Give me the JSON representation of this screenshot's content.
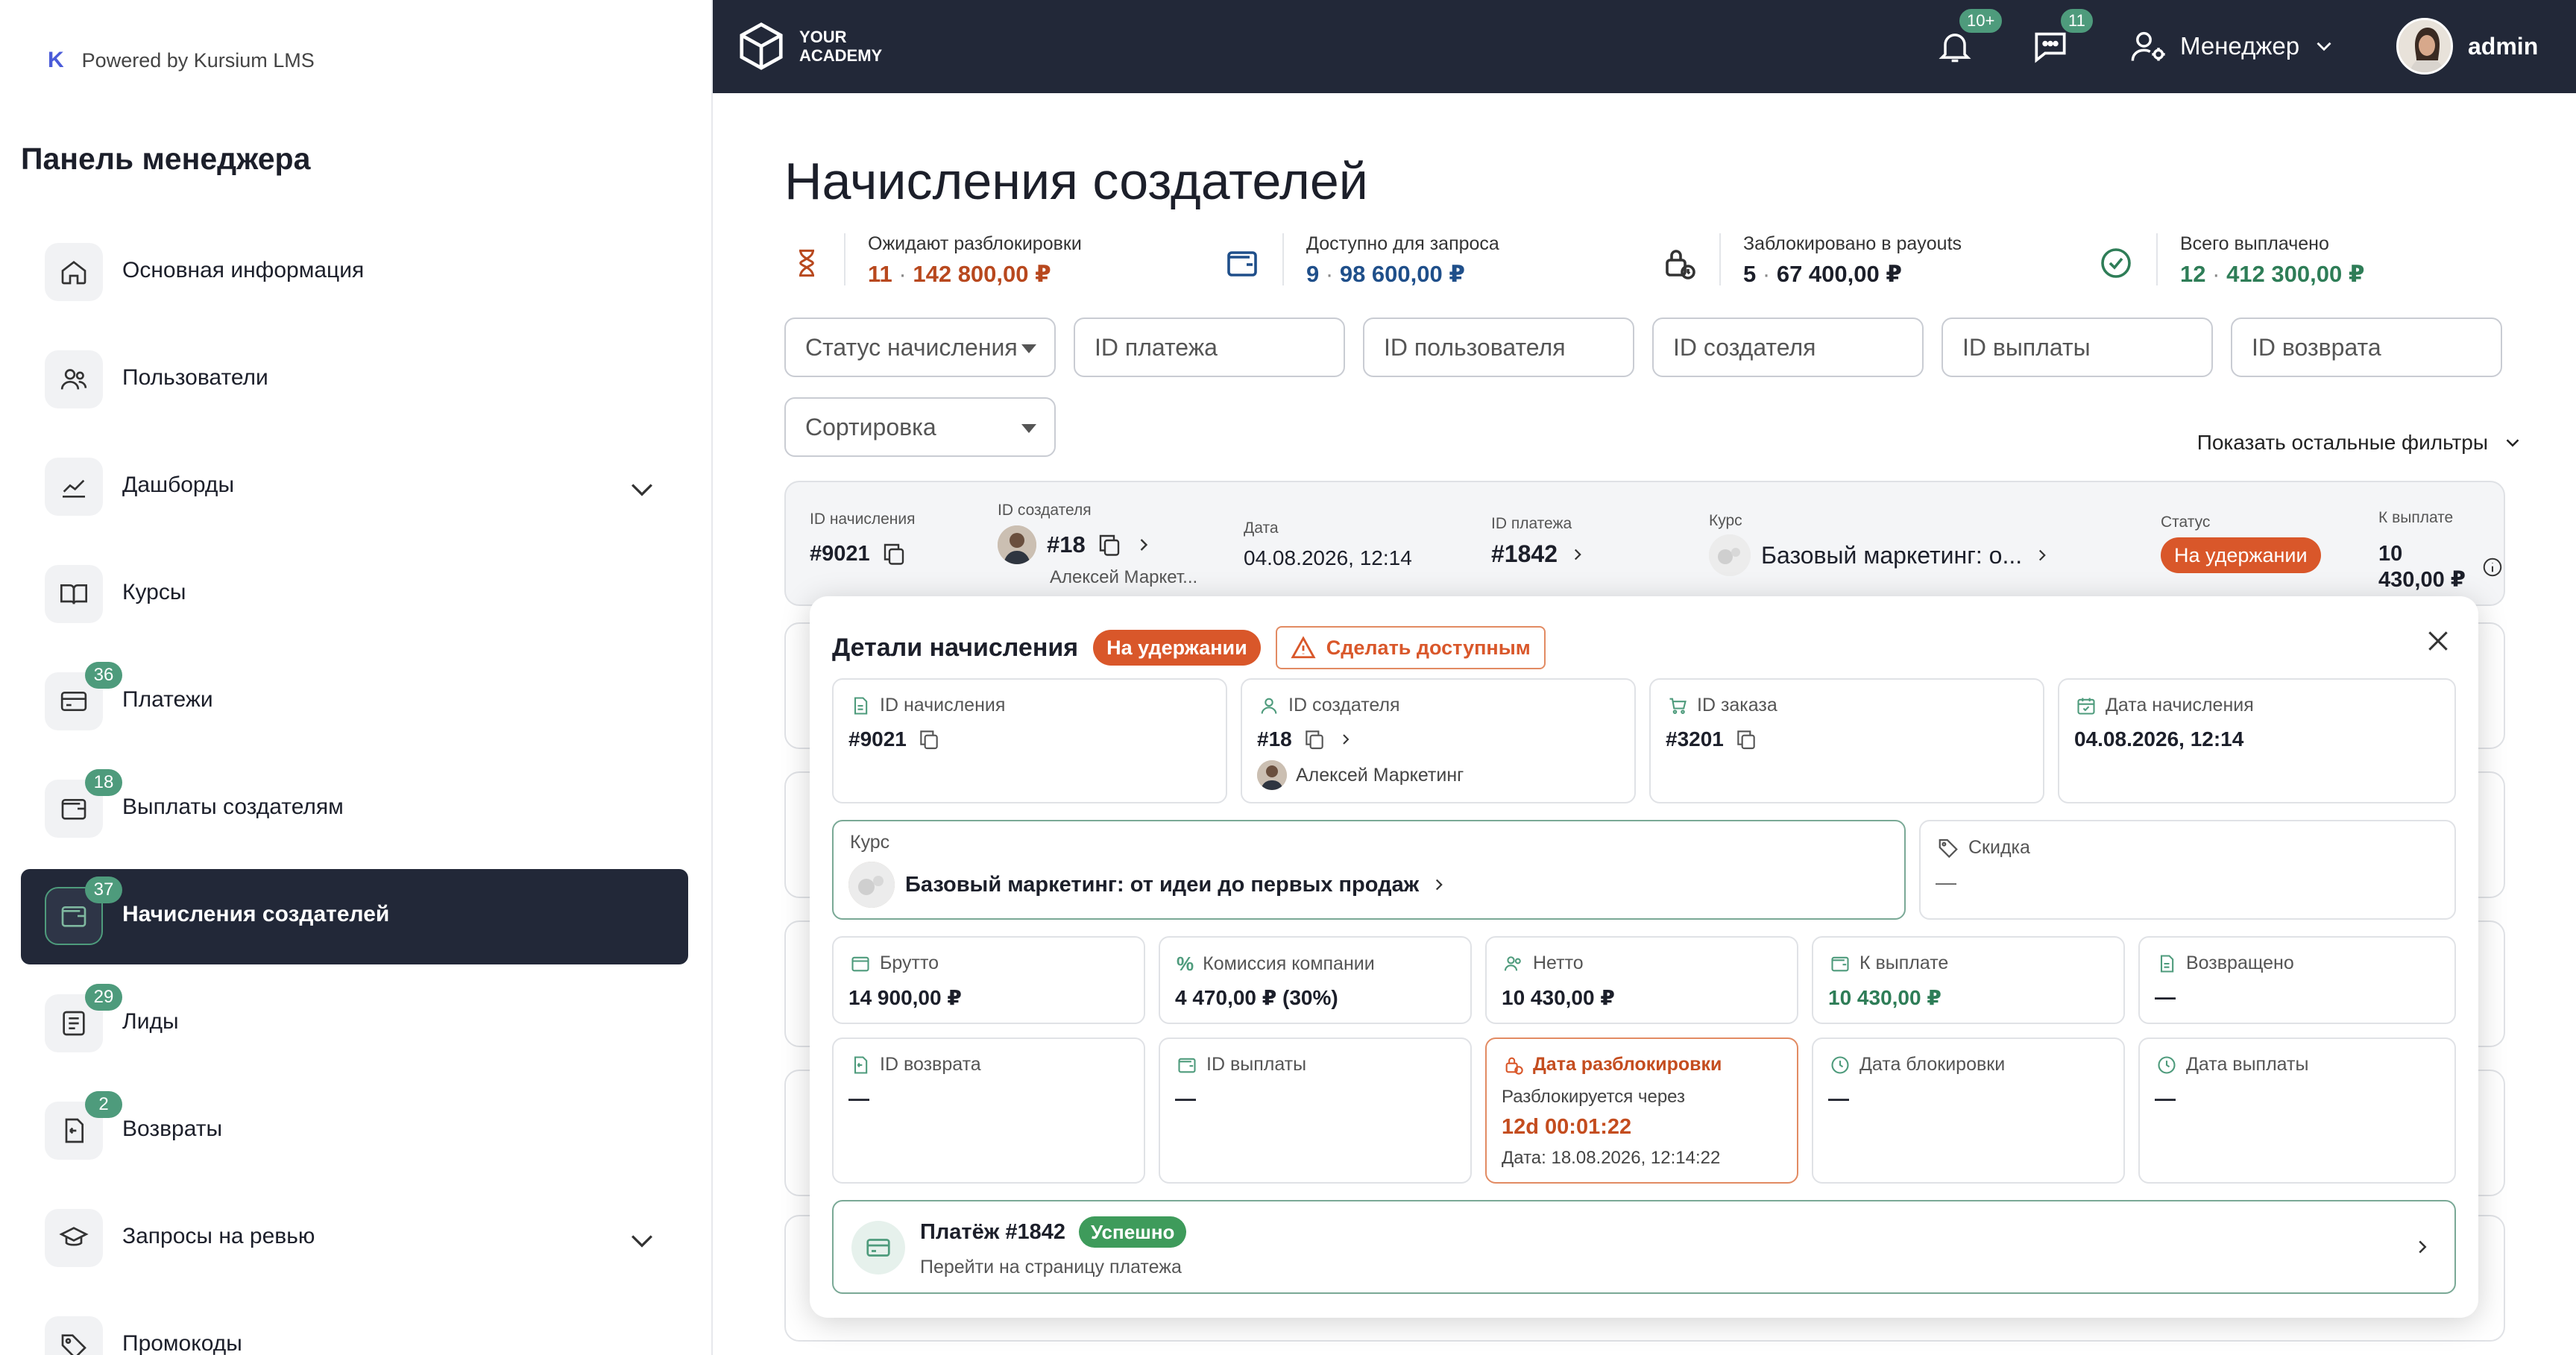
{
  "sidebar": {
    "powered": "Powered by Kursium LMS",
    "logo_letter": "K",
    "title": "Панель менеджера",
    "items": [
      {
        "label": "Основная информация",
        "badge": ""
      },
      {
        "label": "Пользователи",
        "badge": ""
      },
      {
        "label": "Дашборды",
        "badge": ""
      },
      {
        "label": "Курсы",
        "badge": ""
      },
      {
        "label": "Платежи",
        "badge": "36"
      },
      {
        "label": "Выплаты создателям",
        "badge": "18"
      },
      {
        "label": "Начисления создателей",
        "badge": "37"
      },
      {
        "label": "Лиды",
        "badge": "29"
      },
      {
        "label": "Возвраты",
        "badge": "2"
      },
      {
        "label": "Запросы на ревью",
        "badge": ""
      },
      {
        "label": "Промокоды",
        "badge": ""
      }
    ]
  },
  "topbar": {
    "brand_line1": "YOUR",
    "brand_line2": "ACADEMY",
    "notif_badge": "10+",
    "chat_badge": "11",
    "role": "Менеджер",
    "user": "admin"
  },
  "main": {
    "title": "Начисления создателей",
    "stats": [
      {
        "label": "Ожидают разблокировки",
        "count": "11",
        "sep": "·",
        "amount": "142 800,00 ₽",
        "color": "#b8481e"
      },
      {
        "label": "Доступно для запроса",
        "count": "9",
        "sep": "·",
        "amount": "98 600,00 ₽",
        "color": "#1f4f8a"
      },
      {
        "label": "Заблокировано в payouts",
        "count": "5",
        "sep": "·",
        "amount": "67 400,00 ₽",
        "color": "#1c1f2a"
      },
      {
        "label": "Всего выплачено",
        "count": "12",
        "sep": "·",
        "amount": "412 300,00 ₽",
        "color": "#2e7d57"
      }
    ],
    "filters": {
      "status": "Статус начисления",
      "payment_id": "ID платежа",
      "user_id": "ID пользователя",
      "creator_id": "ID создателя",
      "payout_id": "ID выплаты",
      "refund_id": "ID возврата",
      "sort": "Сортировка",
      "more": "Показать остальные фильтры"
    },
    "row": {
      "accrual_h": "ID начисления",
      "accrual_v": "#9021",
      "creator_h": "ID создателя",
      "creator_v": "#18",
      "creator_name": "Алексей Маркет...",
      "date_h": "Дата",
      "date_v": "04.08.2026, 12:14",
      "payment_h": "ID платежа",
      "payment_v": "#1842",
      "course_h": "Курс",
      "course_v": "Базовый маркетинг: о...",
      "status_h": "Статус",
      "status_v": "На удержании",
      "payout_h": "К выплате",
      "payout_v": "10 430,00 ₽"
    },
    "details": {
      "title": "Детали начисления",
      "status": "На удержании",
      "make_available": "Сделать доступным",
      "accrual_id_h": "ID начисления",
      "accrual_id_v": "#9021",
      "creator_id_h": "ID создателя",
      "creator_id_v": "#18",
      "creator_name": "Алексей Маркетинг",
      "order_id_h": "ID заказа",
      "order_id_v": "#3201",
      "accrual_date_h": "Дата начисления",
      "accrual_date_v": "04.08.2026, 12:14",
      "course_h": "Курс",
      "course_v": "Базовый маркетинг: от идеи до первых продаж",
      "discount_h": "Скидка",
      "discount_v": "—",
      "gross_h": "Брутто",
      "gross_v": "14 900,00 ₽",
      "commission_h": "Комиссия компании",
      "commission_v": "4 470,00 ₽ (30%)",
      "net_h": "Нетто",
      "net_v": "10 430,00 ₽",
      "topay_h": "К выплате",
      "topay_v": "10 430,00 ₽",
      "returned_h": "Возвращено",
      "returned_v": "—",
      "refund_id_h": "ID возврата",
      "refund_id_v": "—",
      "payout_id_h": "ID выплаты",
      "payout_id_v": "—",
      "unlock_h": "Дата разблокировки",
      "unlock_sub": "Разблокируется через",
      "unlock_timer": "12d 00:01:22",
      "unlock_date": "Дата: 18.08.2026, 12:14:22",
      "block_date_h": "Дата блокировки",
      "block_date_v": "—",
      "payout_date_h": "Дата выплаты",
      "payout_date_v": "—",
      "payment_title": "Платёж #1842",
      "payment_status": "Успешно",
      "payment_link": "Перейти на страницу платежа"
    }
  }
}
